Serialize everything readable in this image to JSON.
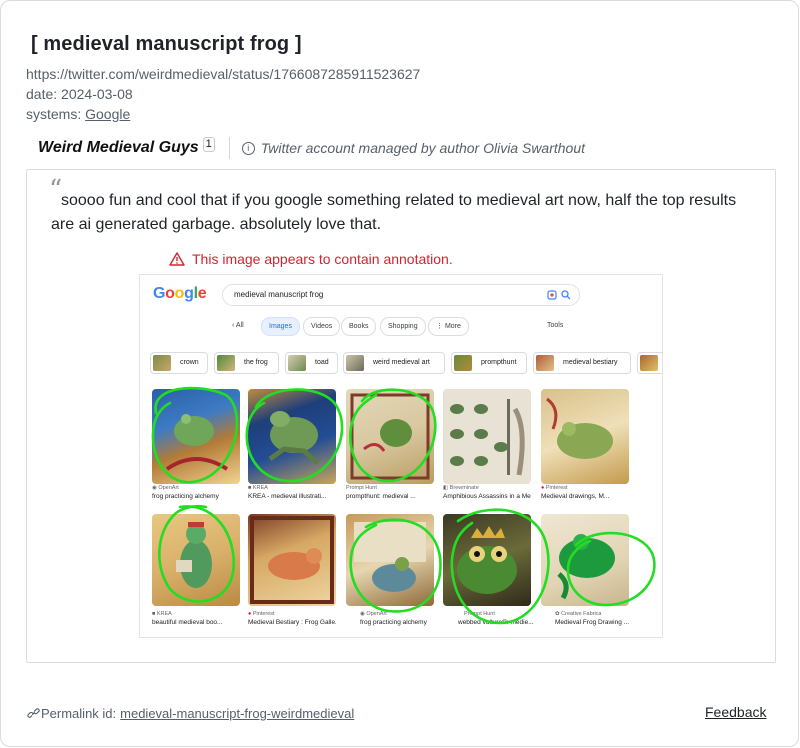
{
  "entry": {
    "title": "[ medieval manuscript frog ]",
    "url": "https://twitter.com/weirdmedieval/status/1766087285911523627",
    "date_label": "date:",
    "date": "2024-03-08",
    "systems_label": "systems:",
    "system": "Google"
  },
  "author": {
    "name": "Weird Medieval Guys",
    "count": "1",
    "note": "Twitter account managed by author Olivia Swarthout"
  },
  "quote": {
    "mark": "“",
    "text": "soooo fun and cool that if you google something related to medieval art now, half the top results are ai generated garbage. absolutely love that."
  },
  "warning": "This image appears to contain annotation.",
  "screenshot": {
    "logo": "Google",
    "query": "medieval manuscript frog",
    "nav": [
      "All",
      "Images",
      "Videos",
      "Books",
      "Shopping",
      "⋮ More",
      "Tools"
    ],
    "chips": [
      "crown",
      "the frog",
      "toad",
      "weird medieval art",
      "prompthunt",
      "medieval bestiary"
    ],
    "results": [
      {
        "source": "OpenArt",
        "caption": "frog practicing alchemy"
      },
      {
        "source": "KREA",
        "caption": "KREA - medieval illustrati..."
      },
      {
        "source": "Prompt Hunt",
        "caption": "prompthunt: medieval ..."
      },
      {
        "source": "Brewminate",
        "caption": "Amphibious Assassins in a Me..."
      },
      {
        "source": "Pinterest",
        "caption": "Medieval drawings, M..."
      },
      {
        "source": "KREA",
        "caption": "beautiful medieval boo..."
      },
      {
        "source": "Pinterest",
        "caption": "Medieval Bestiary : Frog Galle..."
      },
      {
        "source": "OpenArt",
        "caption": "frog practicing alchemy"
      },
      {
        "source": "Prompt Hunt",
        "caption": "webbed vulture®: medie..."
      },
      {
        "source": "Creative Fabrica",
        "caption": "Medieval Frog Drawing ..."
      }
    ]
  },
  "footer": {
    "permalink_label": "Permalink id:",
    "permalink_id": "medieval-manuscript-frog-weirdmedieval",
    "feedback": "Feedback"
  },
  "colors": {
    "annotation": "#22dd22",
    "warning": "#d1242f",
    "google_blue": "#1a73e8"
  }
}
